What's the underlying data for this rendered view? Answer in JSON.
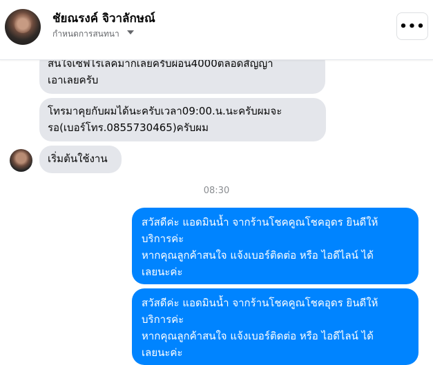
{
  "header": {
    "name": "ชัยณรงค์ จิวาลักษณ์",
    "subtitle": "กำหนดการสนทนา",
    "more_label": "•••"
  },
  "messages": {
    "m1": "สนใจเซฟไรเลคมากเลยครับผ่อน4000ตลอดสัญญา\nเอาเลยครับ",
    "m2": "โทรมาคุยกับผมได้นะครับเวลา09:00.น.นะครับผมจะ\nรอ(เบอร์โทร.0855730465)ครับผม",
    "m3": "เริ่มต้นใช้งาน",
    "timestamp": "08:30",
    "m4": "สวัสดีค่ะ แอดมินน้ำ จากร้านโชคคูณโชคอุดร ยินดีให้\nบริการค่ะ\nหากคุณลูกค้าสนใจ แจ้งเบอร์ติดต่อ หรือ ไอดีไลน์ ได้\nเลยนะค่ะ",
    "m5": "สวัสดีค่ะ แอดมินน้ำ จากร้านโชคคูณโชคอุดร ยินดีให้\nบริการค่ะ\nหากคุณลูกค้าสนใจ แจ้งเบอร์ติดต่อ หรือ ไอดีไลน์ ได้\nเลยนะค่ะ"
  },
  "colors": {
    "outgoing_bubble": "#0084ff",
    "incoming_bubble": "#e4e6eb"
  }
}
